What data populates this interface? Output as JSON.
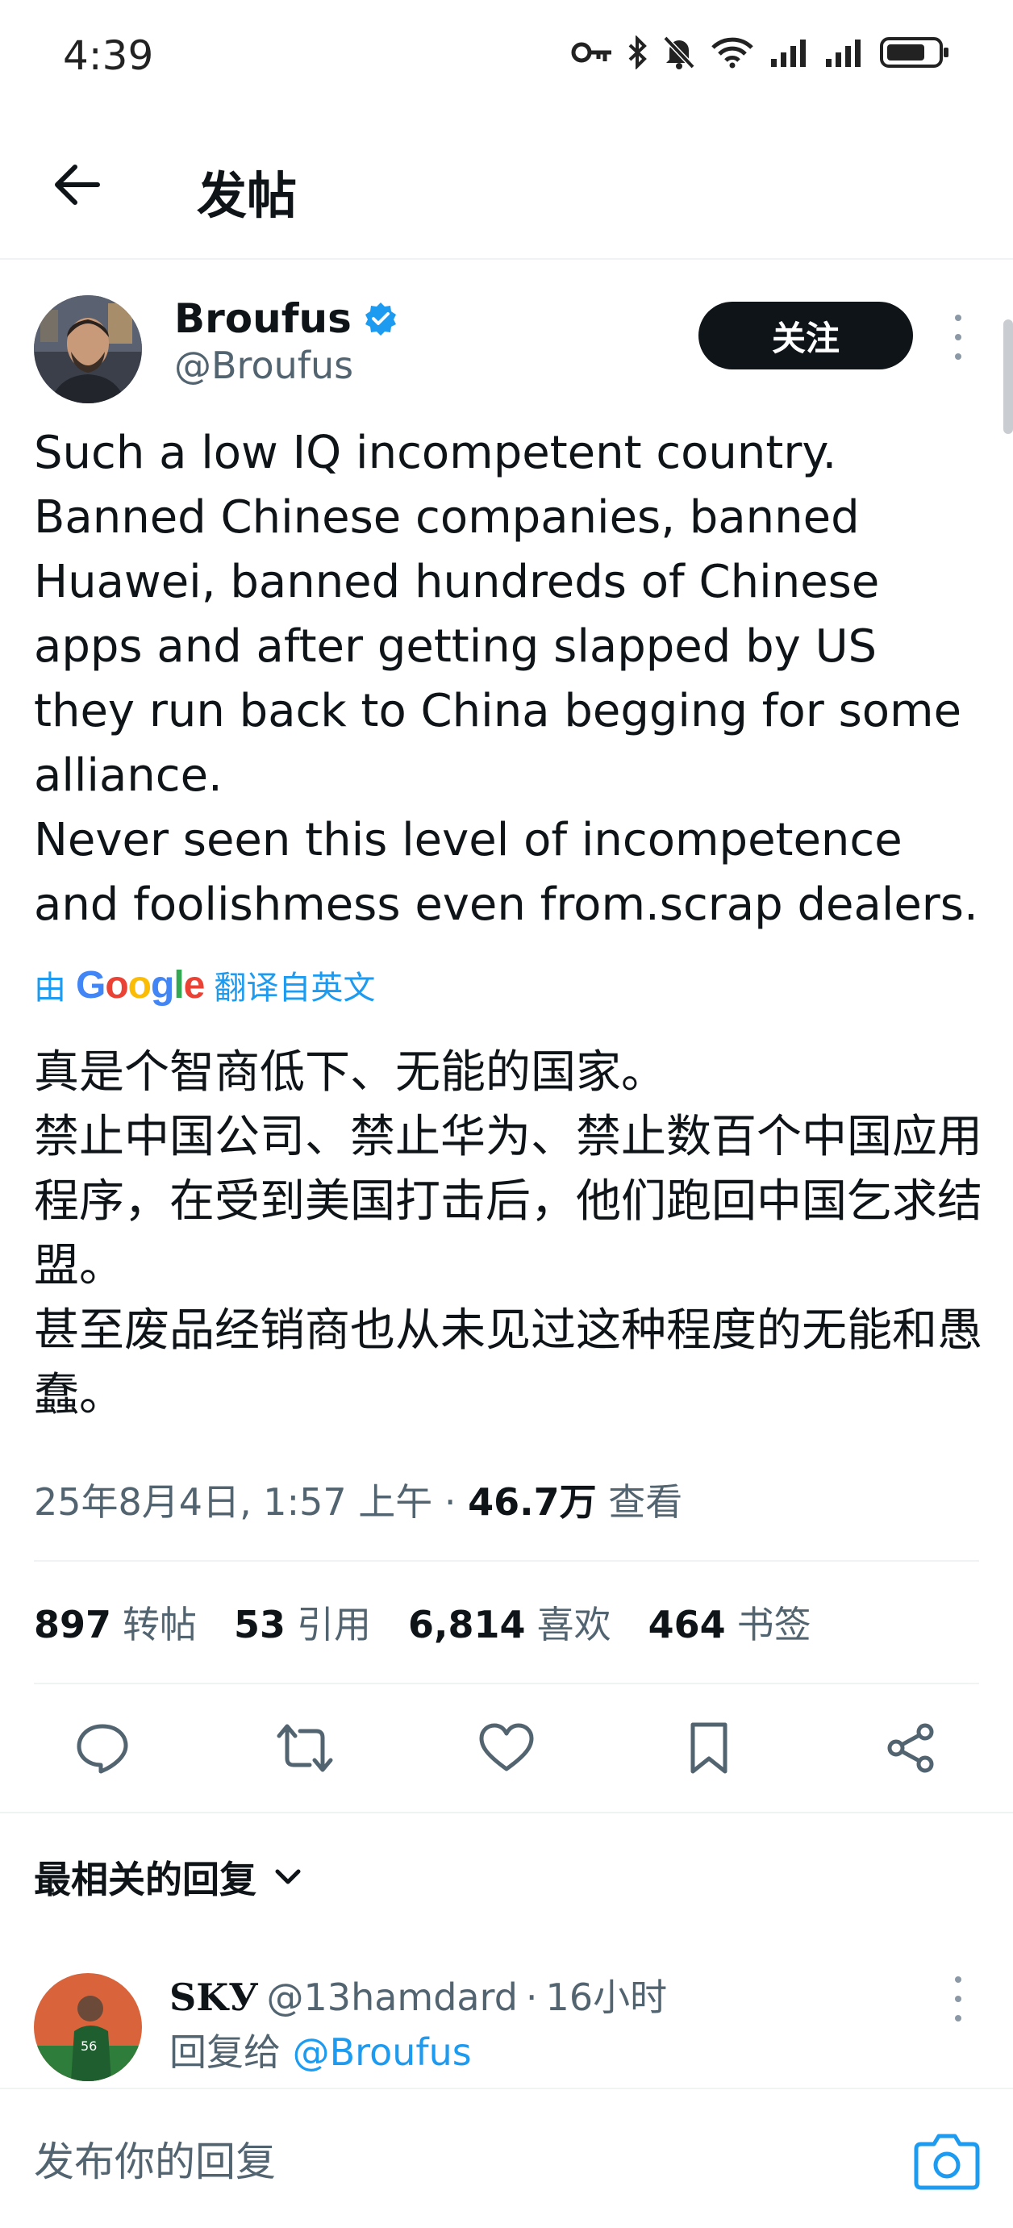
{
  "status_bar": {
    "time": "4:39",
    "icons": [
      "key-icon",
      "bluetooth-icon",
      "mute-icon",
      "wifi-icon",
      "signal-icon",
      "signal-icon",
      "battery-icon"
    ]
  },
  "header": {
    "title": "发帖"
  },
  "author": {
    "name": "Broufus",
    "handle": "@Broufus",
    "verified": true,
    "follow_label": "关注"
  },
  "tweet": {
    "text": "Such a low IQ incompetent country.\nBanned Chinese companies, banned Huawei, banned hundreds of Chinese apps and after getting slapped by US they run back to China begging for some alliance.\nNever seen this level of incompetence and foolishmess even from.scrap dealers.",
    "translate_prefix": "由",
    "translate_brand": "Google",
    "translate_suffix": "翻译自英文",
    "translation": "真是个智商低下、无能的国家。\n禁止中国公司、禁止华为、禁止数百个中国应用程序，在受到美国打击后，他们跑回中国乞求结盟。\n甚至废品经销商也从未见过这种程度的无能和愚蠢。",
    "timestamp": "25年8月4日, 1:57 上午",
    "separator": "·",
    "views": "46.7万",
    "views_label": "查看"
  },
  "stats": [
    {
      "count": "897",
      "label": "转帖"
    },
    {
      "count": "53",
      "label": "引用"
    },
    {
      "count": "6,814",
      "label": "喜欢"
    },
    {
      "count": "464",
      "label": "书签"
    }
  ],
  "actions": [
    "reply-icon",
    "retweet-icon",
    "like-icon",
    "bookmark-icon",
    "share-icon"
  ],
  "replies": {
    "sort_label": "最相关的回复",
    "first": {
      "name": "SKУ",
      "handle": "@13hamdard",
      "separator": "·",
      "time": "16小时",
      "reply_to_prefix": "回复给",
      "reply_to_handle": "@Broufus"
    }
  },
  "compose": {
    "placeholder": "发布你的回复"
  },
  "colors": {
    "accent": "#1d9bf0",
    "text": "#0f1419",
    "muted": "#536471",
    "divider": "#eff3f4"
  }
}
